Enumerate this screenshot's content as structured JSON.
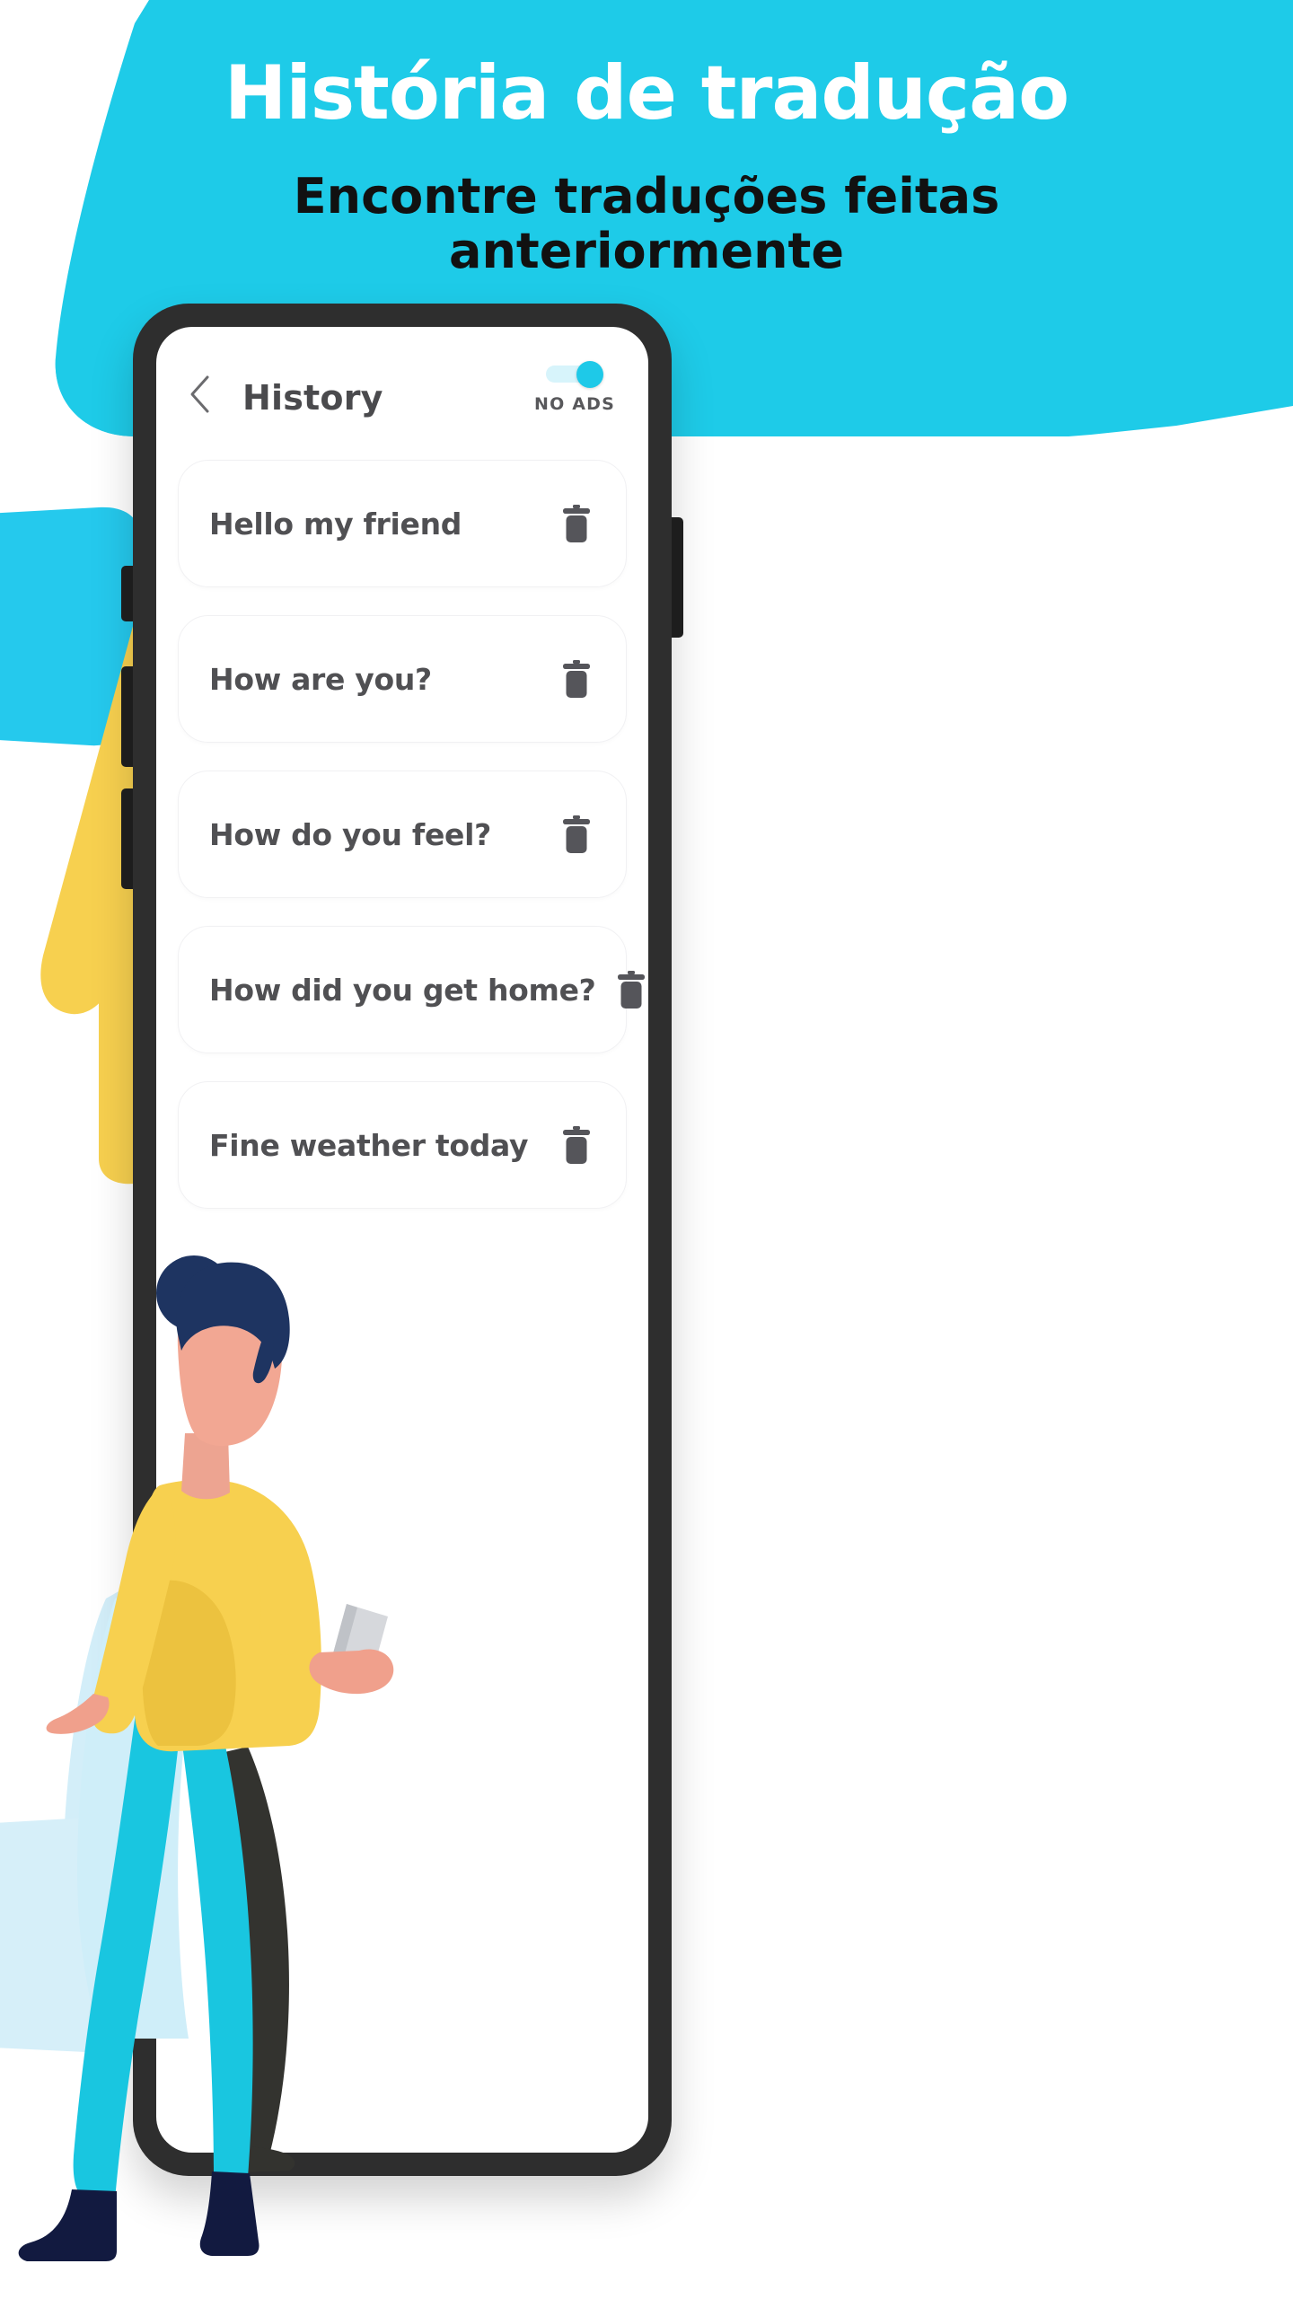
{
  "promo": {
    "headline": "História de tradução",
    "subhead": "Encontre traduções feitas anteriormente"
  },
  "colors": {
    "brand_cyan": "#1ecbe8",
    "banner_cyan": "#1ecbe8",
    "pale_cyan": "#d0eef8",
    "yellow": "#f7d04f",
    "navy": "#1b2b5c",
    "skin": "#f0a08c",
    "text_dark": "#111111",
    "text_gray": "#505053",
    "toggle_on": "#1ec9e8",
    "toggle_track": "#d7f4fb"
  },
  "app": {
    "appbar": {
      "back_icon": "chevron-left-icon",
      "title": "History",
      "no_ads_label": "NO ADS",
      "toggle_state": "on"
    },
    "history": {
      "items": [
        {
          "text": "Hello my friend",
          "delete_icon": "trash-icon"
        },
        {
          "text": "How are you?",
          "delete_icon": "trash-icon"
        },
        {
          "text": "How do you feel?",
          "delete_icon": "trash-icon"
        },
        {
          "text": "How did you get home?",
          "delete_icon": "trash-icon"
        },
        {
          "text": "Fine weather today",
          "delete_icon": "trash-icon"
        }
      ]
    }
  }
}
